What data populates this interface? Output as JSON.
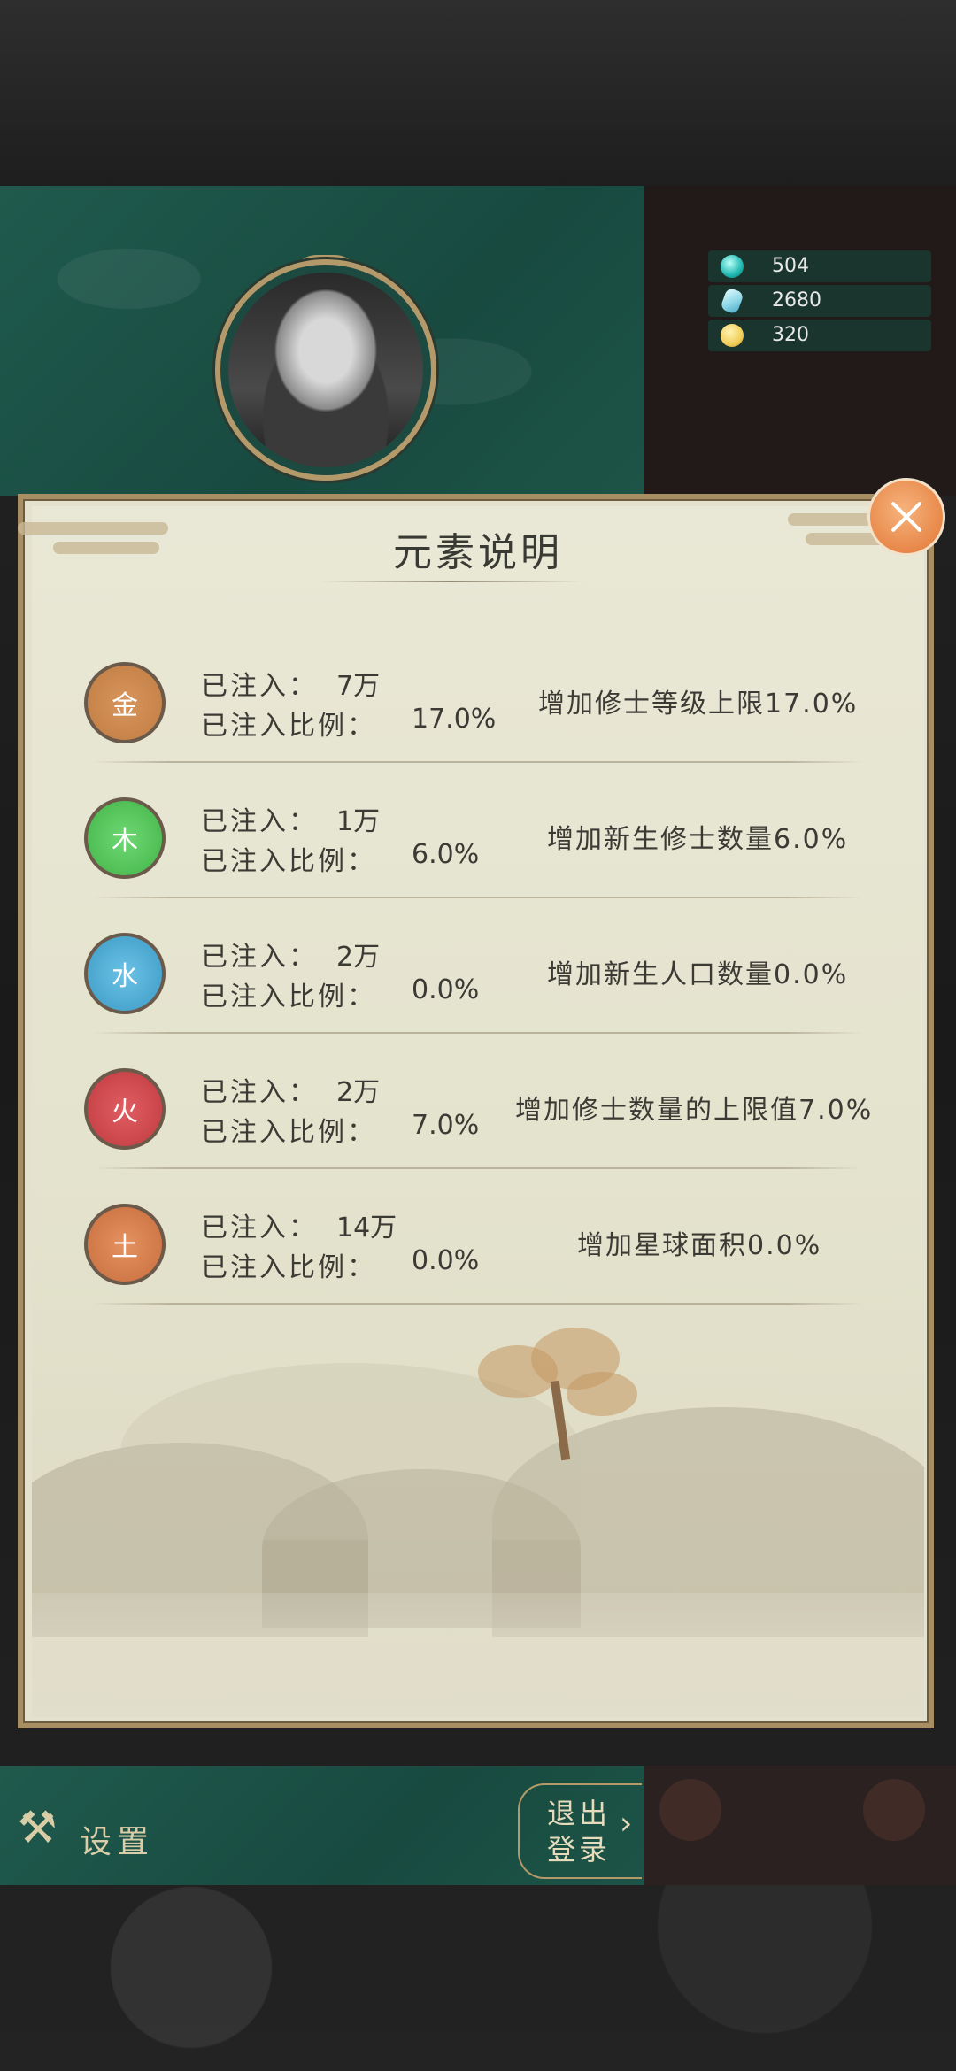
{
  "currency": [
    {
      "icon": "jade-orb-icon",
      "color": "#1fb8b0",
      "value": "504"
    },
    {
      "icon": "crystal-icon",
      "color": "#8ed8e8",
      "value": "2680"
    },
    {
      "icon": "gold-nugget-icon",
      "color": "#f1cf5a",
      "value": "320"
    }
  ],
  "dialog": {
    "title": "元素说明",
    "elements": [
      {
        "glyph": "金",
        "color": "#c7844a",
        "injected_label": "已注入：",
        "injected_value": "7万",
        "ratio_label": "已注入比例：",
        "ratio_value": "17.0%",
        "effect": "增加修士等级上限17.0%"
      },
      {
        "glyph": "木",
        "color": "#4fbf55",
        "injected_label": "已注入：",
        "injected_value": "1万",
        "ratio_label": "已注入比例：",
        "ratio_value": "6.0%",
        "effect": "增加新生修士数量6.0%"
      },
      {
        "glyph": "水",
        "color": "#4aa6cf",
        "injected_label": "已注入：",
        "injected_value": "2万",
        "ratio_label": "已注入比例：",
        "ratio_value": "0.0%",
        "effect": "增加新生人口数量0.0%"
      },
      {
        "glyph": "火",
        "color": "#c9454a",
        "injected_label": "已注入：",
        "injected_value": "2万",
        "ratio_label": "已注入比例：",
        "ratio_value": "7.0%",
        "effect": "增加修士数量的上限值7.0%"
      },
      {
        "glyph": "土",
        "color": "#d07848",
        "injected_label": "已注入：",
        "injected_value": "14万",
        "ratio_label": "已注入比例：",
        "ratio_value": "0.0%",
        "effect": "增加星球面积0.0%"
      }
    ]
  },
  "footer": {
    "settings_label": "设置",
    "logout_line1": "退出",
    "logout_line2": "登录",
    "logout_chevron": "›"
  }
}
